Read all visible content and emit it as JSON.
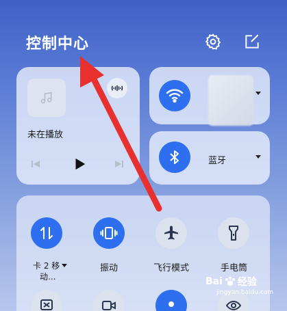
{
  "header": {
    "title": "控制中心",
    "settings_icon": "gear-icon",
    "edit_icon": "edit-icon"
  },
  "media": {
    "status": "未在播放",
    "art_icon": "music-note-icon",
    "cast_icon": "cast-icon"
  },
  "wifi": {
    "label": "",
    "icon": "wifi-icon",
    "state": "on"
  },
  "bluetooth": {
    "label": "蓝牙",
    "icon": "bluetooth-icon",
    "state": "on"
  },
  "toggles": [
    {
      "label": "卡 2 移",
      "label_line2": "动...",
      "icon": "data-transfer-icon",
      "active": true,
      "has_menu": true
    },
    {
      "label": "振动",
      "icon": "vibrate-icon",
      "active": true
    },
    {
      "label": "飞行模式",
      "icon": "airplane-icon",
      "active": false
    },
    {
      "label": "手电筒",
      "icon": "flashlight-icon",
      "active": false
    }
  ],
  "watermark": {
    "brand": "Bai",
    "brand2": "经验",
    "url": "jingyan.baidu.com"
  },
  "colors": {
    "accent": "#2e6ff0",
    "annotation_arrow": "#e8312f"
  }
}
